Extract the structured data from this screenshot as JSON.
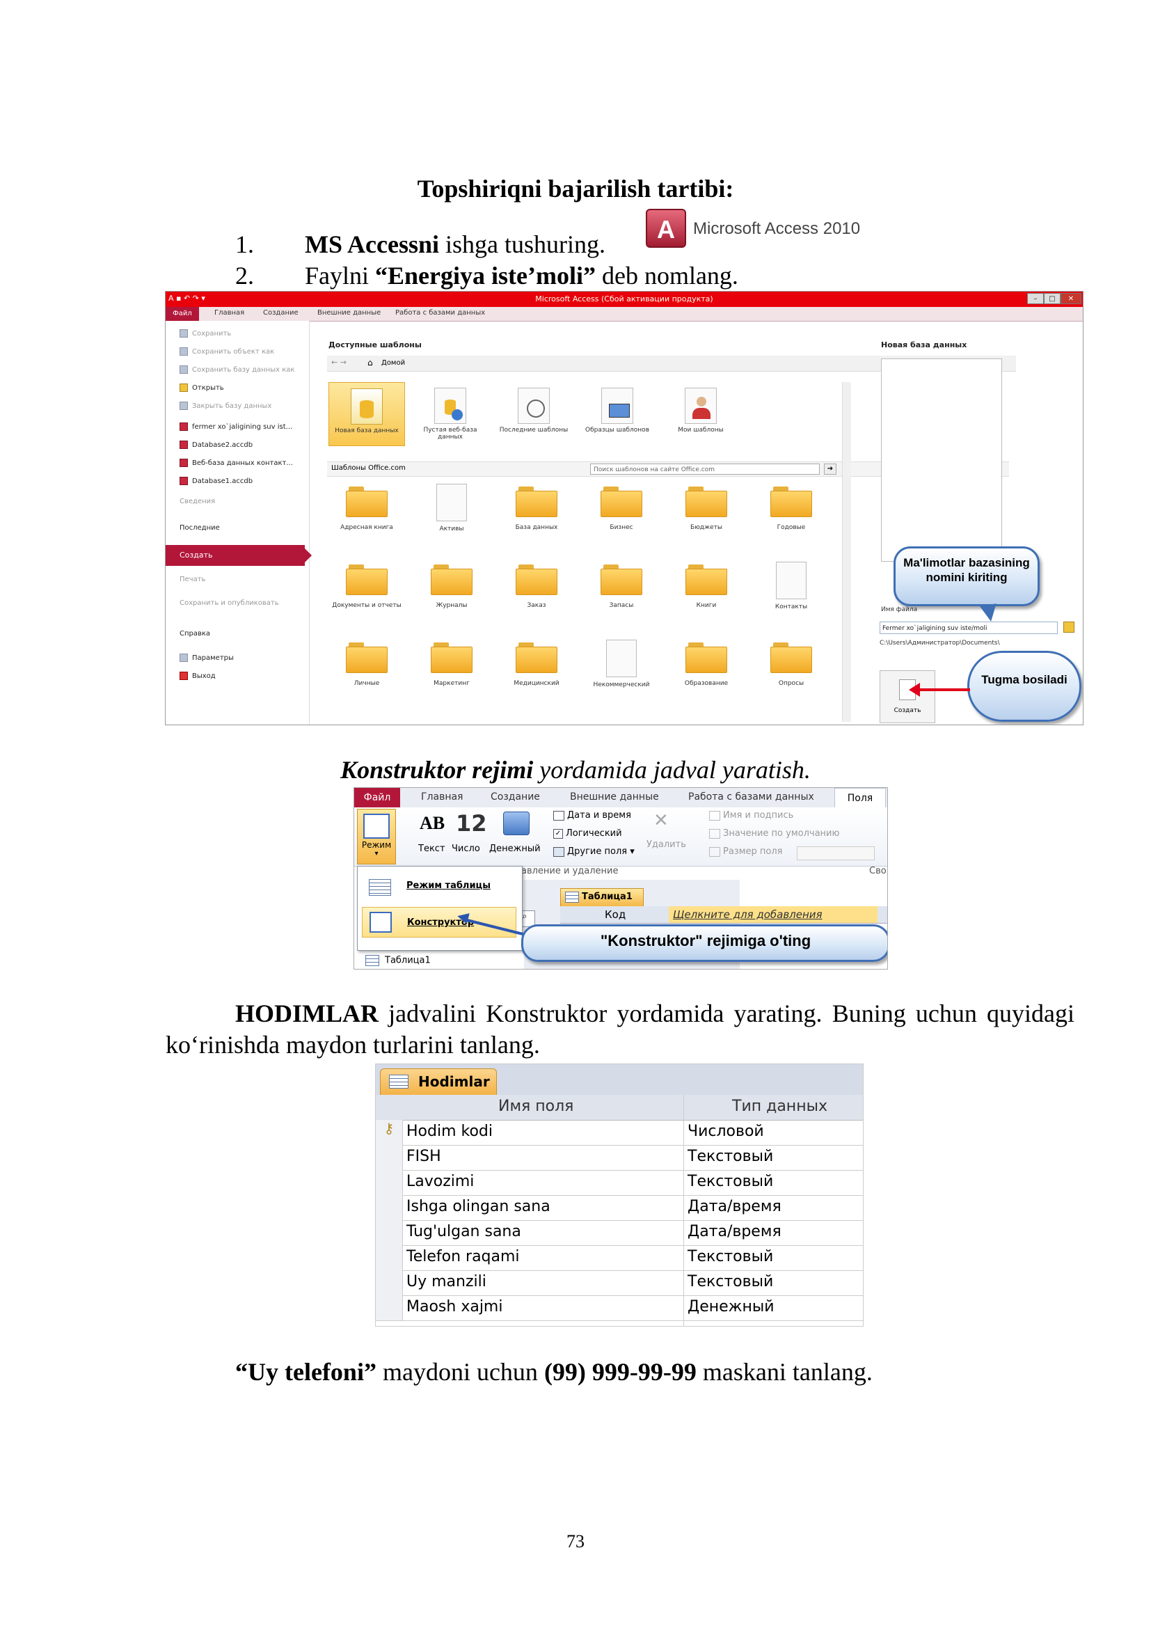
{
  "heading": "Topshiriqni bajarilish tartibi:",
  "steps": [
    {
      "num": "1.",
      "bold": "MS Accessni",
      "rest": " ishga tushuring."
    },
    {
      "num": "2.",
      "pre": "Faylni ",
      "bold": "“Energiya iste’moli”",
      "rest": " deb nomlang."
    }
  ],
  "logo": {
    "letter": "A",
    "text": "Microsoft Access 2010"
  },
  "access_window": {
    "title": "Microsoft Access (Сбой активации продукта)",
    "tabs": [
      "Файл",
      "Главная",
      "Создание",
      "Внешние данные",
      "Работа с базами данных"
    ],
    "left_menu": [
      {
        "label": "Сохранить",
        "icon": "save-icon"
      },
      {
        "label": "Сохранить объект как",
        "icon": "save-as-icon"
      },
      {
        "label": "Сохранить базу данных как",
        "icon": "save-db-icon"
      },
      {
        "label": "Открыть",
        "icon": "open-folder-icon"
      },
      {
        "label": "Закрыть базу данных",
        "icon": "close-db-icon"
      },
      {
        "label": "fermer xo`jaligining suv ist...",
        "icon": "access-file-icon"
      },
      {
        "label": "Database2.accdb",
        "icon": "access-file-icon"
      },
      {
        "label": "Веб-база данных контакт...",
        "icon": "access-file-icon"
      },
      {
        "label": "Database1.accdb",
        "icon": "access-file-icon"
      },
      {
        "label": "Сведения",
        "icon": ""
      },
      {
        "label": "Последние",
        "icon": ""
      },
      {
        "label": "Создать",
        "icon": ""
      },
      {
        "label": "Печать",
        "icon": ""
      },
      {
        "label": "Сохранить и опубликовать",
        "icon": ""
      },
      {
        "label": "Справка",
        "icon": ""
      },
      {
        "label": "Параметры",
        "icon": "options-icon"
      },
      {
        "label": "Выход",
        "icon": "exit-icon"
      }
    ],
    "available_templates": "Доступные шаблоны",
    "home": "Домой",
    "top_tiles": [
      "Новая база данных",
      "Пустая веб-база данных",
      "Последние шаблоны",
      "Образцы шаблонов",
      "Мои шаблоны"
    ],
    "office_templates": "Шаблоны Office.com",
    "search_placeholder": "Поиск шаблонов на сайте Office.com",
    "folders": [
      "Адресная книга",
      "Активы",
      "База данных",
      "Бизнес",
      "Бюджеты",
      "Годовые",
      "Документы и отчеты",
      "Журналы",
      "Заказ",
      "Запасы",
      "Книги",
      "Контакты",
      "Личные",
      "Маркетинг",
      "Медицинский",
      "Некоммерческий",
      "Образование",
      "Опросы"
    ],
    "new_db_title": "Новая база данных",
    "filename_label": "Имя файла",
    "filename_value": "Fermer xo`jaligining suv iste/moli",
    "path": "C:\\Users\\Администратор\\Documents\\",
    "create_button": "Создать",
    "callout1": "Ma'limotlar bazasining nomini kiriting",
    "callout2": "Tugma bosiladi"
  },
  "section_title": {
    "bold": "Konstruktor rejimi",
    "rest": " yordamida jadval yaratish."
  },
  "ribbon_window": {
    "tabs": [
      "Файл",
      "Главная",
      "Создание",
      "Внешние данные",
      "Работа с базами данных",
      "Поля"
    ],
    "mode_label": "Режим",
    "type_buttons": [
      {
        "icon": "AB",
        "label": "Текст"
      },
      {
        "icon": "12",
        "label": "Число"
      },
      {
        "icon": "money-icon",
        "label": "Денежный"
      }
    ],
    "add_items": [
      "Дата и время",
      "Логический",
      "Другие поля ▾"
    ],
    "delete_label": "Удалить",
    "props": [
      "Имя и подпись",
      "Значение по умолчанию",
      "Размер поля"
    ],
    "group_label": "авление и удаление",
    "group_label_right": "Сво",
    "dropdown_items": [
      "Режим таблицы",
      "Конструктор"
    ],
    "doc_tab": "Таблица1",
    "col_code": "Код",
    "col_add": "Щелкните для добавления",
    "nav_item": "Таблица1",
    "callout": "\"Konstruktor\" rejimiga o'ting"
  },
  "paragraph": {
    "bold": "HODIMLAR",
    "rest": " jadvalini Konstruktor yordamida yarating. Buning uchun quyidagi ko‘rinishda maydon turlarini tanlang."
  },
  "fields_table": {
    "tab": "Hodimlar",
    "headers": [
      "Имя поля",
      "Тип данных"
    ],
    "rows": [
      [
        "Hodim kodi",
        "Числовой"
      ],
      [
        "FISH",
        "Текстовый"
      ],
      [
        "Lavozimi",
        "Текстовый"
      ],
      [
        "Ishga olingan sana",
        "Дата/время"
      ],
      [
        "Tug'ulgan sana",
        "Дата/время"
      ],
      [
        "Telefon raqami",
        "Текстовый"
      ],
      [
        "Uy manzili",
        "Текстовый"
      ],
      [
        "Maosh xajmi",
        "Денежный"
      ]
    ]
  },
  "last_line": {
    "b1": "“Uy telefoni”",
    "t1": " maydoni uchun ",
    "b2": "(99) 999-99-99",
    "t2": " maskani tanlang."
  },
  "page_number": "73"
}
